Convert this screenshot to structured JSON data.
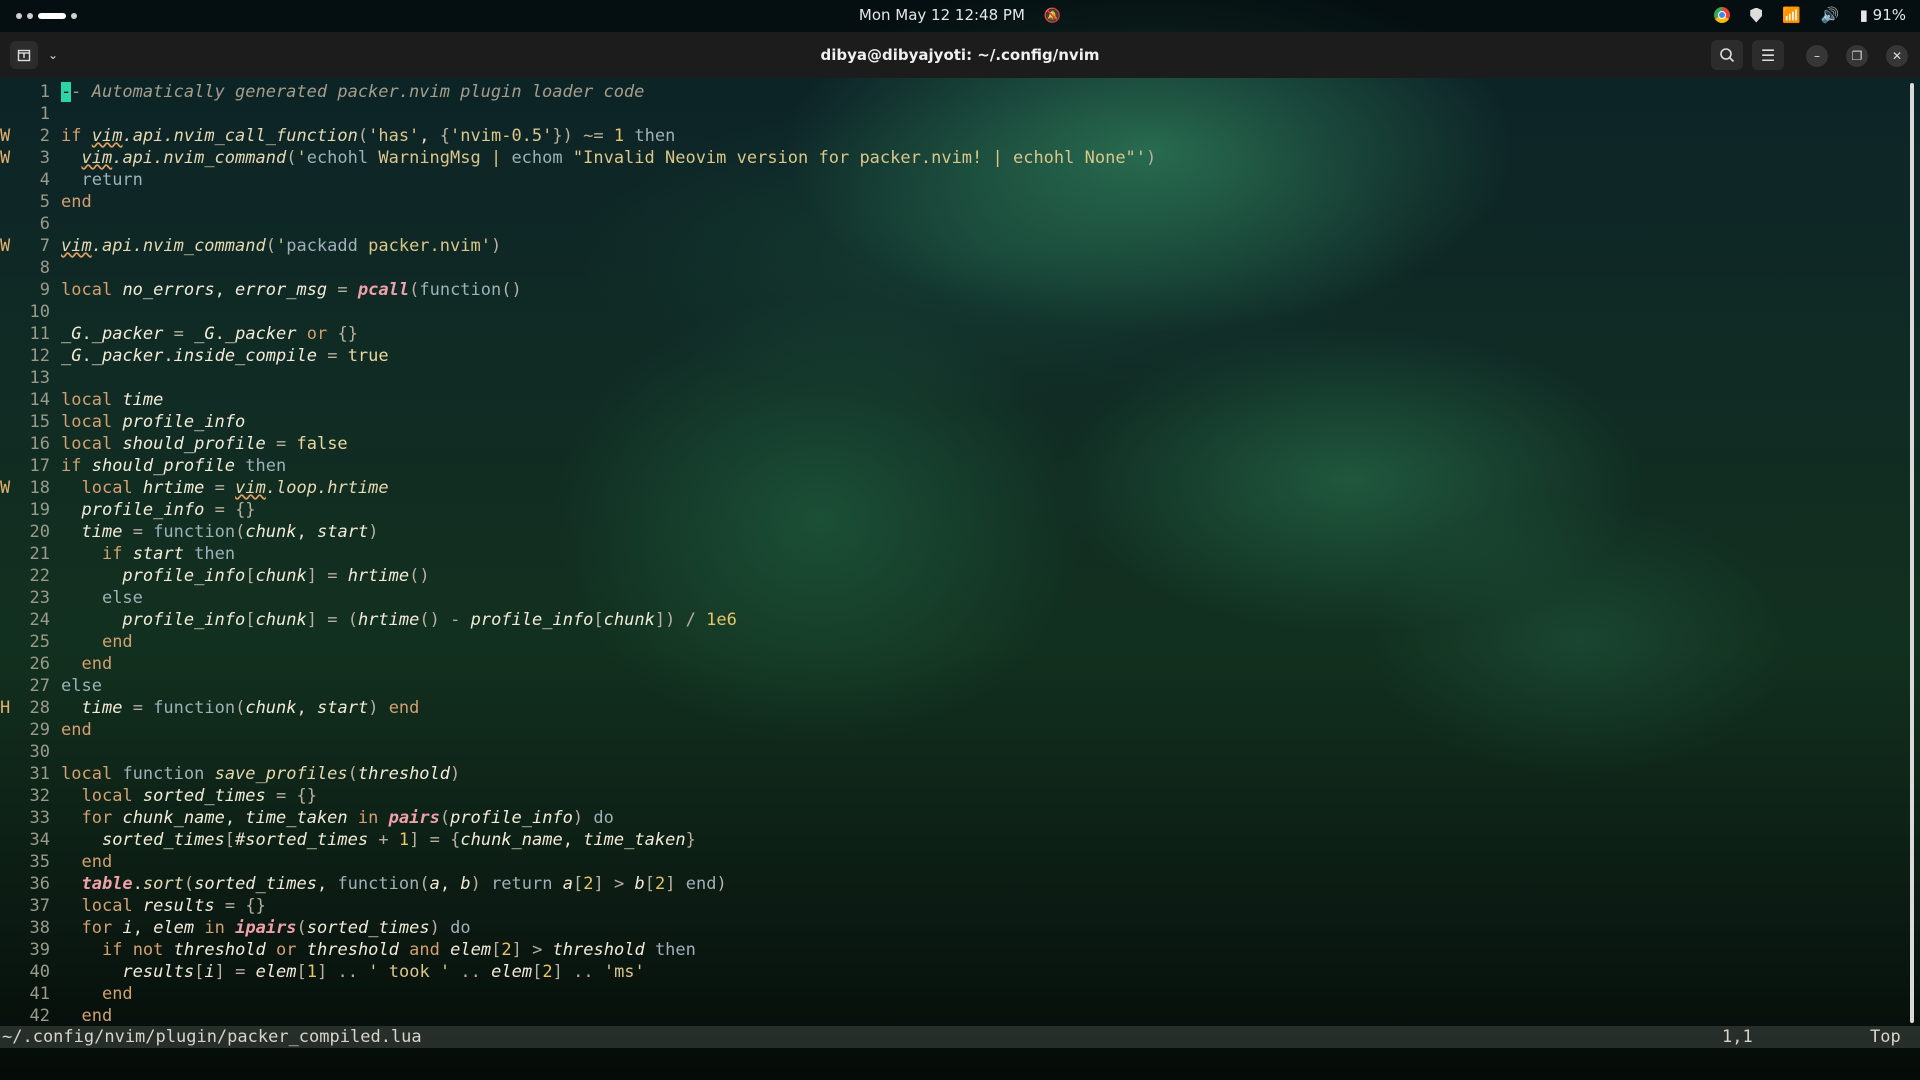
{
  "topbar": {
    "datetime": "Mon May 12  12:48 PM",
    "battery": "91%"
  },
  "window": {
    "title": "dibya@dibyajyoti: ~/.config/nvim"
  },
  "editor": {
    "lines": [
      {
        "num": "1",
        "sign": "",
        "html": "<span class='cursor'>-</span><span class='cm'>- Automatically generated packer.nvim plugin loader code</span>"
      },
      {
        "num": "1",
        "sign": "",
        "html": ""
      },
      {
        "num": "2",
        "sign": "W",
        "html": "<span class='kw'>if</span> <span class='fn'><span class='warn'>vim</span>.api.nvim_call_function</span><span class='op'>(</span><span class='str'>'has'</span>, <span class='op'>{</span><span class='str'>'nvim-0.5'</span><span class='op'>}</span><span class='op'>)</span> <span class='op'>~=</span> <span class='num'>1</span> <span class='kw2'>then</span>"
      },
      {
        "num": "3",
        "sign": "W",
        "html": "  <span class='fn'><span class='warn'>vim</span>.api.nvim_command</span><span class='op'>(</span><span class='str'>'</span><span class='kw2'>echohl</span> <span class='str'>WarningMsg | </span><span class='kw2'>echom</span> <span class='str'>\"Invalid Neovim version for packer.nvim! | echohl None\"'</span><span class='op'>)</span>"
      },
      {
        "num": "4",
        "sign": "",
        "html": "  <span class='kw2'>return</span>"
      },
      {
        "num": "5",
        "sign": "",
        "html": "<span class='kw'>end</span>"
      },
      {
        "num": "6",
        "sign": "",
        "html": ""
      },
      {
        "num": "7",
        "sign": "W",
        "html": "<span class='fn'><span class='warn'>vim</span>.api.nvim_command</span><span class='op'>(</span><span class='str'>'</span><span class='kw2'>packadd</span> <span class='str'>packer.nvim'</span><span class='op'>)</span>"
      },
      {
        "num": "8",
        "sign": "",
        "html": ""
      },
      {
        "num": "9",
        "sign": "",
        "html": "<span class='kw'>local</span> <span class='var'>no_errors</span>, <span class='var'>error_msg</span> <span class='op'>=</span> <span class='builtin'>pcall</span><span class='op'>(</span><span class='kw2'>function</span><span class='op'>()</span>"
      },
      {
        "num": "10",
        "sign": "",
        "html": ""
      },
      {
        "num": "11",
        "sign": "",
        "html": "<span class='var'>_G</span>.<span class='var'>_packer</span> <span class='op'>=</span> <span class='var'>_G</span>.<span class='var'>_packer</span> <span class='kw'>or</span> <span class='op'>{}</span>"
      },
      {
        "num": "12",
        "sign": "",
        "html": "<span class='var'>_G</span>.<span class='var'>_packer</span>.<span class='var'>inside_compile</span> <span class='op'>=</span> <span class='bool'>true</span>"
      },
      {
        "num": "13",
        "sign": "",
        "html": ""
      },
      {
        "num": "14",
        "sign": "",
        "html": "<span class='kw'>local</span> <span class='var'>time</span>"
      },
      {
        "num": "15",
        "sign": "",
        "html": "<span class='kw'>local</span> <span class='var'>profile_info</span>"
      },
      {
        "num": "16",
        "sign": "",
        "html": "<span class='kw'>local</span> <span class='var'>should_profile</span> <span class='op'>=</span> <span class='bool'>false</span>"
      },
      {
        "num": "17",
        "sign": "",
        "html": "<span class='kw'>if</span> <span class='var'>should_profile</span> <span class='kw2'>then</span>"
      },
      {
        "num": "18",
        "sign": "W",
        "html": "  <span class='kw'>local</span> <span class='var'>hrtime</span> <span class='op'>=</span> <span class='fn'><span class='warn'>vim</span>.loop.hrtime</span>"
      },
      {
        "num": "19",
        "sign": "",
        "html": "  <span class='var'>profile_info</span> <span class='op'>=</span> <span class='op'>{}</span>"
      },
      {
        "num": "20",
        "sign": "",
        "html": "  <span class='var'>time</span> <span class='op'>=</span> <span class='kw2'>function</span><span class='op'>(</span><span class='var'>chunk</span>, <span class='var'>start</span><span class='op'>)</span>"
      },
      {
        "num": "21",
        "sign": "",
        "html": "    <span class='kw'>if</span> <span class='var'>start</span> <span class='kw2'>then</span>"
      },
      {
        "num": "22",
        "sign": "",
        "html": "      <span class='var'>profile_info</span><span class='op'>[</span><span class='var'>chunk</span><span class='op'>]</span> <span class='op'>=</span> <span class='var'>hrtime</span><span class='op'>()</span>"
      },
      {
        "num": "23",
        "sign": "",
        "html": "    <span class='kw2'>else</span>"
      },
      {
        "num": "24",
        "sign": "",
        "html": "      <span class='var'>profile_info</span><span class='op'>[</span><span class='var'>chunk</span><span class='op'>]</span> <span class='op'>=</span> <span class='op'>(</span><span class='var'>hrtime</span><span class='op'>()</span> <span class='op'>-</span> <span class='var'>profile_info</span><span class='op'>[</span><span class='var'>chunk</span><span class='op'>])</span> <span class='op'>/</span> <span class='num'>1e6</span>"
      },
      {
        "num": "25",
        "sign": "",
        "html": "    <span class='kw'>end</span>"
      },
      {
        "num": "26",
        "sign": "",
        "html": "  <span class='kw'>end</span>"
      },
      {
        "num": "27",
        "sign": "",
        "html": "<span class='kw2'>else</span>"
      },
      {
        "num": "28",
        "sign": "H",
        "html": "  <span class='var'>time</span> <span class='op'>=</span> <span class='kw2'>function</span><span class='op'>(</span><span class='var'>chunk</span>, <span class='var'>start</span><span class='op'>)</span> <span class='kw'>end</span>"
      },
      {
        "num": "29",
        "sign": "",
        "html": "<span class='kw'>end</span>"
      },
      {
        "num": "30",
        "sign": "",
        "html": ""
      },
      {
        "num": "31",
        "sign": "",
        "html": "<span class='kw'>local</span> <span class='kw2'>function</span> <span class='fn'>save_profiles</span><span class='op'>(</span><span class='var'>threshold</span><span class='op'>)</span>"
      },
      {
        "num": "32",
        "sign": "",
        "html": "  <span class='kw'>local</span> <span class='var'>sorted_times</span> <span class='op'>=</span> <span class='op'>{}</span>"
      },
      {
        "num": "33",
        "sign": "",
        "html": "  <span class='kw'>for</span> <span class='var'>chunk_name</span>, <span class='var'>time_taken</span> <span class='kw'>in</span> <span class='builtin'>pairs</span><span class='op'>(</span><span class='var'>profile_info</span><span class='op'>)</span> <span class='kw2'>do</span>"
      },
      {
        "num": "34",
        "sign": "",
        "html": "    <span class='var'>sorted_times</span><span class='op'>[</span>#<span class='var'>sorted_times</span> <span class='op'>+</span> <span class='num'>1</span><span class='op'>]</span> <span class='op'>=</span> <span class='op'>{</span><span class='var'>chunk_name</span>, <span class='var'>time_taken</span><span class='op'>}</span>"
      },
      {
        "num": "35",
        "sign": "",
        "html": "  <span class='kw'>end</span>"
      },
      {
        "num": "36",
        "sign": "",
        "html": "  <span class='builtin'>table</span>.<span class='fn'>sort</span><span class='op'>(</span><span class='var'>sorted_times</span>, <span class='kw2'>function</span><span class='op'>(</span><span class='var'>a</span>, <span class='var'>b</span><span class='op'>)</span> <span class='kw2'>return</span> <span class='var'>a</span><span class='op'>[</span><span class='num'>2</span><span class='op'>]</span> <span class='op'>&gt;</span> <span class='var'>b</span><span class='op'>[</span><span class='num'>2</span><span class='op'>]</span> <span class='kw2'>end</span><span class='op'>)</span>"
      },
      {
        "num": "37",
        "sign": "",
        "html": "  <span class='kw'>local</span> <span class='var'>results</span> <span class='op'>=</span> <span class='op'>{}</span>"
      },
      {
        "num": "38",
        "sign": "",
        "html": "  <span class='kw'>for</span> <span class='var'>i</span>, <span class='var'>elem</span> <span class='kw'>in</span> <span class='builtin'>ipairs</span><span class='op'>(</span><span class='var'>sorted_times</span><span class='op'>)</span> <span class='kw2'>do</span>"
      },
      {
        "num": "39",
        "sign": "",
        "html": "    <span class='kw'>if</span> <span class='kw'>not</span> <span class='var'>threshold</span> <span class='kw'>or</span> <span class='var'>threshold</span> <span class='kw'>and</span> <span class='var'>elem</span><span class='op'>[</span><span class='num'>2</span><span class='op'>]</span> <span class='op'>&gt;</span> <span class='var'>threshold</span> <span class='kw2'>then</span>"
      },
      {
        "num": "40",
        "sign": "",
        "html": "      <span class='var'>results</span><span class='op'>[</span><span class='var'>i</span><span class='op'>]</span> <span class='op'>=</span> <span class='var'>elem</span><span class='op'>[</span><span class='num'>1</span><span class='op'>]</span> <span class='op'>..</span> <span class='str'>' took '</span> <span class='op'>..</span> <span class='var'>elem</span><span class='op'>[</span><span class='num'>2</span><span class='op'>]</span> <span class='op'>..</span> <span class='str'>'ms'</span>"
      },
      {
        "num": "41",
        "sign": "",
        "html": "    <span class='kw'>end</span>"
      },
      {
        "num": "42",
        "sign": "",
        "html": "  <span class='kw'>end</span>"
      }
    ]
  },
  "statusline": {
    "file": "~/.config/nvim/plugin/packer_compiled.lua",
    "position": "1,1",
    "scroll": "Top"
  }
}
